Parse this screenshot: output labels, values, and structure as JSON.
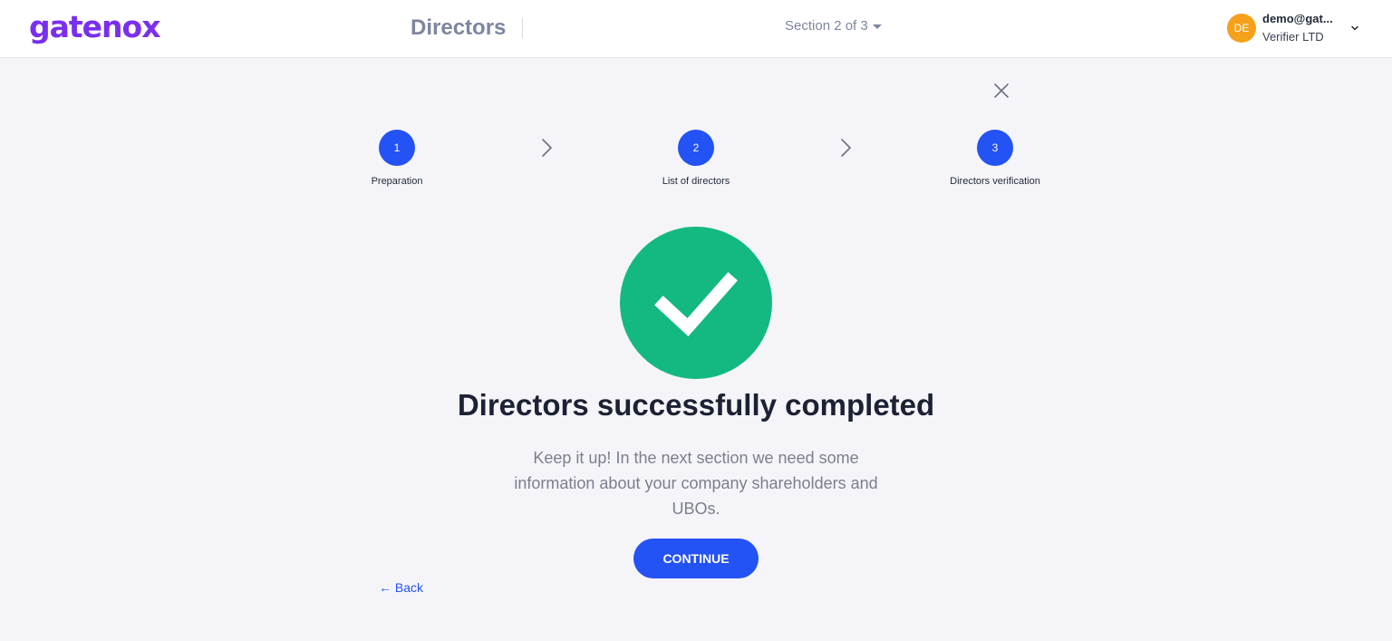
{
  "header": {
    "logo": "gatenox",
    "title": "Directors",
    "section_label": "Section 2 of 3",
    "user": {
      "initials": "DE",
      "email": "demo@gat...",
      "organization": "Verifier LTD"
    }
  },
  "stepper": {
    "steps": [
      {
        "number": "1",
        "label": "Preparation"
      },
      {
        "number": "2",
        "label": "List of directors"
      },
      {
        "number": "3",
        "label": "Directors verification"
      }
    ]
  },
  "success": {
    "headline": "Directors successfully completed",
    "description": "Keep it up! In the next section we need some information about your company shareholders and UBOs."
  },
  "actions": {
    "continue_label": "CONTINUE",
    "back_label": "Back"
  },
  "colors": {
    "brand": "#7a2ff0",
    "primary": "#2352f5",
    "success": "#13b981",
    "avatar": "#f6a11b"
  }
}
